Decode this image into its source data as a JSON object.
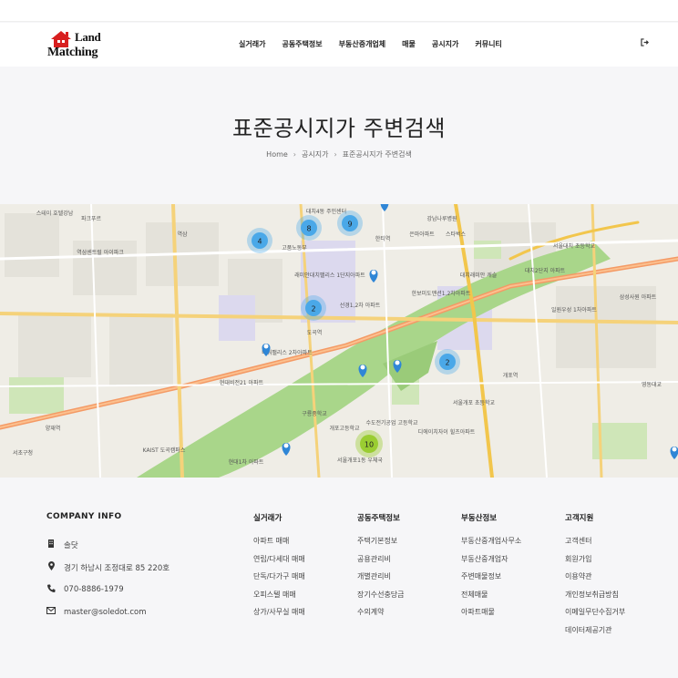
{
  "logo": {
    "line1": "Land",
    "line2": "Matching"
  },
  "nav": [
    "실거래가",
    "공동주택정보",
    "부동산중개업체",
    "매물",
    "공시지가",
    "커뮤니티"
  ],
  "logout_icon": "sign-out-icon",
  "page": {
    "title": "표준공시지가 주변검색",
    "breadcrumb": [
      "Home",
      "공시지가",
      "표준공시지가 주변검색"
    ]
  },
  "map": {
    "clusters": [
      {
        "label": "4"
      },
      {
        "label": "8"
      },
      {
        "label": "9"
      },
      {
        "label": "2"
      },
      {
        "label": "2"
      },
      {
        "label": "10"
      }
    ],
    "place_labels": [
      "스테이 호텔강남",
      "파크푸르",
      "역삼",
      "역삼센트럴 아이파크",
      "고품노동부",
      "대치4동 주민센터",
      "강남나루병원",
      "은마아파트",
      "스타벅스",
      "서울대치 초등학교",
      "한티역",
      "래미안대치팰리스 1단지아파트",
      "선경1,2차 아파트",
      "한보미도맨션1,2차아파트",
      "개포역",
      "서울개포 초등학교",
      "대치래미안 캐슬",
      "대치2단지 아파트",
      "서울개포 우체국",
      "현대1차 아파트",
      "도곡역",
      "타워팰리스 2차아파트",
      "수도전기공업 고등학교",
      "디에이치자이 힐츠아파트",
      "구룡중학교",
      "서울개포1동 우체국",
      "개포고등학교",
      "일원우성 1차아파트",
      "KAIST 도곡캠퍼스",
      "서초구청",
      "양재역",
      "영동대교",
      "삼성사원 아파트"
    ]
  },
  "footer": {
    "company": {
      "title": "COMPANY INFO",
      "name": "솔닷",
      "address": "경기 하남시 조정대로 85 220호",
      "phone": "070-8886-1979",
      "email": "master@soledot.com",
      "icons": [
        "building-icon",
        "map-marker-icon",
        "phone-icon",
        "envelope-icon"
      ]
    },
    "columns": [
      {
        "title": "실거래가",
        "items": [
          "아파트 매매",
          "연립/다세대 매매",
          "단독/다가구 매매",
          "오피스텔 매매",
          "상가/사무실 매매"
        ]
      },
      {
        "title": "공동주택정보",
        "items": [
          "주택기본정보",
          "공용관리비",
          "개별관리비",
          "장기수선충당금",
          "수의계약"
        ]
      },
      {
        "title": "부동산정보",
        "items": [
          "부동산중개업사무소",
          "부동산중개업자",
          "주변매물정보",
          "전체매물",
          "아파트매물"
        ]
      },
      {
        "title": "고객지원",
        "items": [
          "고객센터",
          "회원가입",
          "이용약관",
          "개인정보취급방침",
          "이메일무단수집거부",
          "데이터제공기관"
        ]
      }
    ]
  },
  "colors": {
    "accent_cluster_blue": "#4aa8e8",
    "cluster_green": "#9acd32",
    "marker_blue": "#2f86d6",
    "road_yellow": "#f2c64c",
    "road_orange": "#f28a52",
    "park_green": "#b9dd9a",
    "river": "#9cd07d"
  }
}
